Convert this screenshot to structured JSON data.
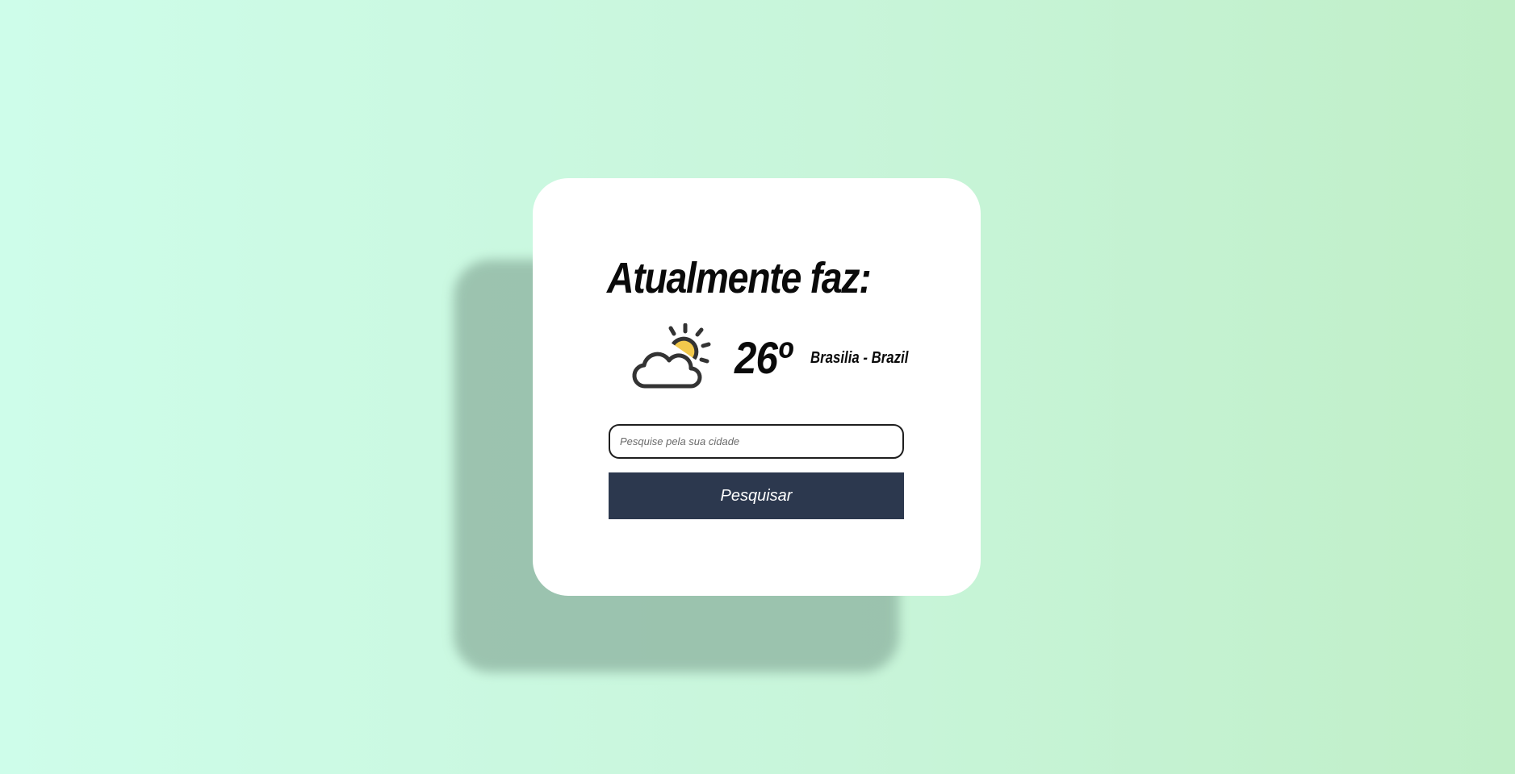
{
  "card": {
    "title": "Atualmente faz:"
  },
  "weather": {
    "icon": "partly-cloudy-icon",
    "temperature": "26º",
    "location": "Brasilia - Brazil"
  },
  "search": {
    "placeholder": "Pesquise pela sua cidade",
    "value": "",
    "button_label": "Pesquisar"
  },
  "colors": {
    "background_start": "#cefdea",
    "background_end": "#c0efc8",
    "card": "#ffffff",
    "button": "#2c384e",
    "sun": "#f2c94c",
    "icon_stroke": "#333333"
  }
}
